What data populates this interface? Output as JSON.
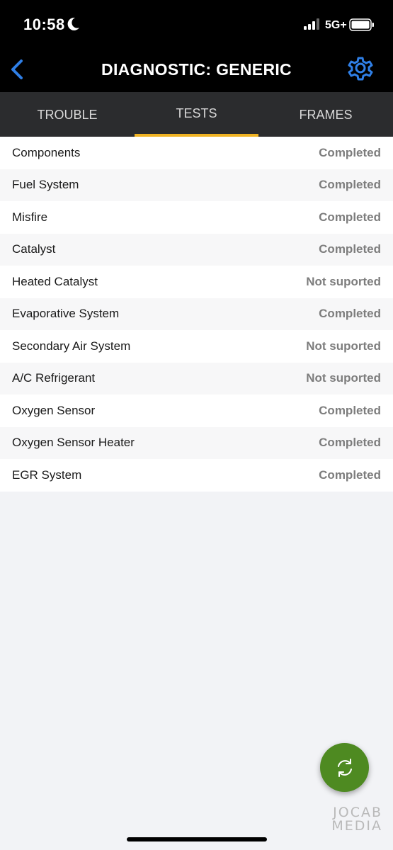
{
  "status_bar": {
    "time": "10:58",
    "network": "5G+"
  },
  "nav": {
    "title": "DIAGNOSTIC: GENERIC",
    "back_icon": "chevron-left-icon",
    "settings_icon": "gear-icon",
    "accent": "#2f7fe6"
  },
  "tabs": [
    {
      "label": "TROUBLE",
      "active": false
    },
    {
      "label": "TESTS",
      "active": true
    },
    {
      "label": "FRAMES",
      "active": false
    }
  ],
  "tests": [
    {
      "name": "Components",
      "status": "Completed"
    },
    {
      "name": "Fuel System",
      "status": "Completed"
    },
    {
      "name": "Misfire",
      "status": "Completed"
    },
    {
      "name": "Catalyst",
      "status": "Completed"
    },
    {
      "name": "Heated Catalyst",
      "status": "Not suported"
    },
    {
      "name": "Evaporative System",
      "status": "Completed"
    },
    {
      "name": "Secondary Air System",
      "status": "Not suported"
    },
    {
      "name": "A/C Refrigerant",
      "status": "Not suported"
    },
    {
      "name": "Oxygen Sensor",
      "status": "Completed"
    },
    {
      "name": "Oxygen Sensor Heater",
      "status": "Completed"
    },
    {
      "name": "EGR System",
      "status": "Completed"
    }
  ],
  "fab": {
    "icon": "refresh-icon",
    "color": "#4e8a21"
  },
  "watermark": {
    "line1": "JOCAB",
    "line2": "MEDIA"
  },
  "colors": {
    "tab_indicator": "#f0b323",
    "header_bg": "#000000",
    "tabs_bg": "#2b2c2e"
  }
}
